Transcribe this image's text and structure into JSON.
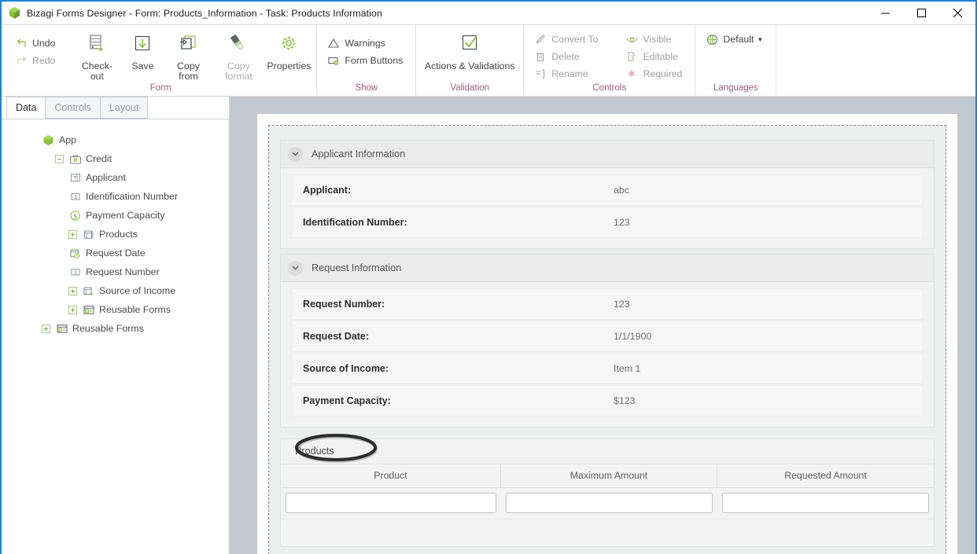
{
  "window": {
    "title": "Bizagi Forms Designer  - Form: Products_Information - Task:  Products Information",
    "logo_icon": "bizagi-cube-icon",
    "minimize_label": "–",
    "maximize_label": "☐",
    "close_label": "✕"
  },
  "ribbon": {
    "groups": [
      {
        "name": "Form",
        "label": "Form",
        "small_items": [
          {
            "label": "Undo",
            "icon": "undo-arrow-icon",
            "dim": false
          },
          {
            "label": "Redo",
            "icon": "redo-arrow-icon",
            "dim": true
          }
        ],
        "big_items": [
          {
            "label": "Check-out",
            "icon": "check-out-icon",
            "dim": false
          },
          {
            "label": "Save",
            "icon": "save-down-arrow-icon",
            "dim": false
          },
          {
            "label": "Copy from",
            "icon": "copy-from-icon",
            "dim": false
          },
          {
            "label": "Copy format",
            "icon": "copy-format-brush-icon",
            "dim": true
          },
          {
            "label": "Properties",
            "icon": "gear-properties-icon",
            "dim": false
          }
        ]
      },
      {
        "name": "Show",
        "label": "Show",
        "small_items": [
          {
            "label": "Warnings",
            "icon": "warning-triangle-icon",
            "dim": false
          },
          {
            "label": "Form Buttons",
            "icon": "form-buttons-icon",
            "dim": false
          }
        ],
        "big_items": []
      },
      {
        "name": "Validation",
        "label": "Validation",
        "small_items": [],
        "big_items": [
          {
            "label": "Actions & Validations",
            "icon": "checkmark-box-icon",
            "dim": false
          }
        ]
      },
      {
        "name": "Controls",
        "label": "Controls",
        "small_items": [
          {
            "label": "Convert To",
            "icon": "convert-to-pencil-icon",
            "dim": true
          },
          {
            "label": "Delete",
            "icon": "trash-delete-icon",
            "dim": true
          },
          {
            "label": "Rename",
            "icon": "rename-tag-icon",
            "dim": true
          },
          {
            "label": "Visible",
            "icon": "eye-visible-icon",
            "dim": true
          },
          {
            "label": "Editable",
            "icon": "editable-page-icon",
            "dim": true
          },
          {
            "label": "Required",
            "icon": "required-asterisk-icon",
            "dim": true
          }
        ],
        "big_items": []
      },
      {
        "name": "Languages",
        "label": "Languages",
        "small_items": [
          {
            "label": "Default",
            "icon": "globe-language-icon",
            "dim": false,
            "dropdown": true
          }
        ],
        "big_items": []
      }
    ]
  },
  "sidebar": {
    "tabs": [
      {
        "label": "Data",
        "active": true
      },
      {
        "label": "Controls",
        "active": false
      },
      {
        "label": "Layout",
        "active": false
      }
    ],
    "tree": [
      {
        "label": "App",
        "indent": 0,
        "expander": "none",
        "icon": "app-cube-icon"
      },
      {
        "label": "Credit",
        "indent": 1,
        "expander": "minus",
        "icon": "entity-briefcase-icon"
      },
      {
        "label": "Applicant",
        "indent": 2,
        "expander": "none",
        "icon": "text-attribute-icon"
      },
      {
        "label": "Identification Number",
        "indent": 2,
        "expander": "none",
        "icon": "number-attribute-icon"
      },
      {
        "label": "Payment Capacity",
        "indent": 2,
        "expander": "none",
        "icon": "money-attribute-icon"
      },
      {
        "label": "Products",
        "indent": 2,
        "expander": "plus",
        "icon": "collection-table-icon"
      },
      {
        "label": "Request Date",
        "indent": 2,
        "expander": "none",
        "icon": "date-calendar-icon"
      },
      {
        "label": "Request Number",
        "indent": 2,
        "expander": "none",
        "icon": "number-attribute-icon"
      },
      {
        "label": "Source of Income",
        "indent": 2,
        "expander": "plus",
        "icon": "related-entity-icon"
      },
      {
        "label": "Reusable Forms",
        "indent": 2,
        "expander": "plus",
        "icon": "reusable-forms-icon"
      },
      {
        "label": "Reusable Forms",
        "indent": 1,
        "expander": "plus",
        "icon": "reusable-forms-icon"
      }
    ]
  },
  "form": {
    "sections": [
      {
        "title": "Applicant Information",
        "collapse_icon": "chevron-down-icon",
        "rows": [
          {
            "label": "Applicant:",
            "value": "abc"
          },
          {
            "label": "Identification Number:",
            "value": "123"
          }
        ]
      },
      {
        "title": "Request Information",
        "collapse_icon": "chevron-down-icon",
        "rows": [
          {
            "label": "Request Number:",
            "value": "123"
          },
          {
            "label": "Request Date:",
            "value": "1/1/1900"
          },
          {
            "label": "Source of Income:",
            "value": "Item 1"
          },
          {
            "label": "Payment Capacity:",
            "value": "$123"
          }
        ]
      }
    ],
    "products": {
      "title": "Products",
      "annotation": "products-highlight-ellipse",
      "columns": [
        "Product",
        "Maximum Amount",
        "Requested Amount"
      ],
      "rows": [
        {
          "product": "",
          "maximum_amount": "",
          "requested_amount": ""
        }
      ]
    }
  },
  "colors": {
    "accent_blue": "#1883d7",
    "ribbon_group_label": "#9b5c7a",
    "bizagi_green": "#76a740",
    "canvas_backdrop": "#c2c8cf"
  }
}
